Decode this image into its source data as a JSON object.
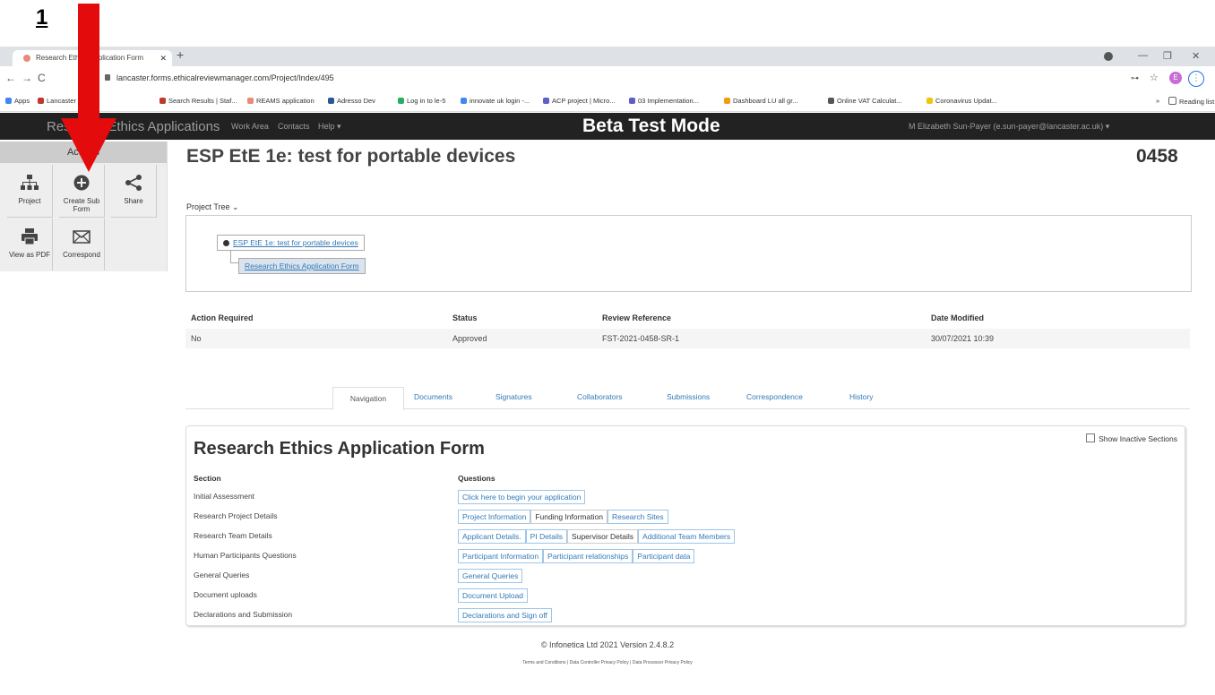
{
  "annotation": {
    "step": "1"
  },
  "browser": {
    "tab_title": "Research Ethics Application Form",
    "new_tab": "+",
    "url": "lancaster.forms.ethicalreviewmanager.com/Project/Index/495",
    "profile_initial": "E",
    "bookmarks": [
      "Apps",
      "Lancaster U...",
      "Search Results | Staf...",
      "REAMS application",
      "Adresso Dev",
      "Log in to le-5",
      "innovate uk login -...",
      "ACP project | Micro...",
      "03 Implementation...",
      "Dashboard LU all gr...",
      "Online VAT Calculat...",
      "Coronavirus Updat..."
    ],
    "more_bookmarks": "»",
    "reading_list": "Reading list"
  },
  "appnav": {
    "brand": "Research Ethics Applications",
    "work_area": "Work Area",
    "contacts": "Contacts",
    "help": "Help ▾",
    "mode": "Beta Test Mode",
    "user": "M Elizabeth Sun-Payer (e.sun-payer@lancaster.ac.uk) ▾"
  },
  "sidebar": {
    "header": "Actions",
    "buttons": [
      {
        "label": "Project",
        "icon": "sitemap-icon"
      },
      {
        "label": "Create Sub Form",
        "icon": "plus-circle-icon"
      },
      {
        "label": "Share",
        "icon": "share-icon"
      },
      {
        "label": "View as PDF",
        "icon": "print-icon"
      },
      {
        "label": "Correspond",
        "icon": "envelope-icon"
      }
    ]
  },
  "project": {
    "title": "ESP EtE 1e: test for portable devices",
    "number": "0458",
    "tree_label": "Project Tree ⌄",
    "tree_root": "ESP EtE 1e: test for portable devices",
    "tree_child": "Research Ethics Application Form"
  },
  "info": {
    "headers": [
      "Action Required",
      "Status",
      "Review Reference",
      "Date Modified"
    ],
    "values": [
      "No",
      "Approved",
      "FST-2021-0458-SR-1",
      "30/07/2021 10:39"
    ]
  },
  "tabs": [
    "Navigation",
    "Documents",
    "Signatures",
    "Collaborators",
    "Submissions",
    "Correspondence",
    "History"
  ],
  "form": {
    "title": "Research Ethics Application Form",
    "show_inactive": "Show Inactive Sections",
    "col_section": "Section",
    "col_questions": "Questions",
    "rows": [
      {
        "section": "Initial Assessment",
        "questions": [
          "Click here to begin your application"
        ]
      },
      {
        "section": "Research Project Details",
        "questions": [
          "Project Information",
          "Funding Information",
          "Research Sites"
        ]
      },
      {
        "section": "Research Team Details",
        "questions": [
          "Applicant Details.",
          "PI Details",
          "Supervisor Details",
          "Additional Team Members"
        ]
      },
      {
        "section": "Human Participants Questions",
        "questions": [
          "Participant Information",
          "Participant relationships",
          "Participant data"
        ]
      },
      {
        "section": "General Queries",
        "questions": [
          "General Queries"
        ]
      },
      {
        "section": "Document uploads",
        "questions": [
          "Document Upload"
        ]
      },
      {
        "section": "Declarations and Submission",
        "questions": [
          "Declarations and Sign off"
        ]
      }
    ]
  },
  "footer": {
    "copyright": "© Infonetica Ltd 2021 Version 2.4.8.2",
    "links": "Terms and Conditions | Data Controller Privacy Policy | Data Processor Privacy Policy"
  },
  "colors": {
    "arrow": "#e30b0b",
    "navbar": "#222222",
    "link": "#337ab7"
  }
}
